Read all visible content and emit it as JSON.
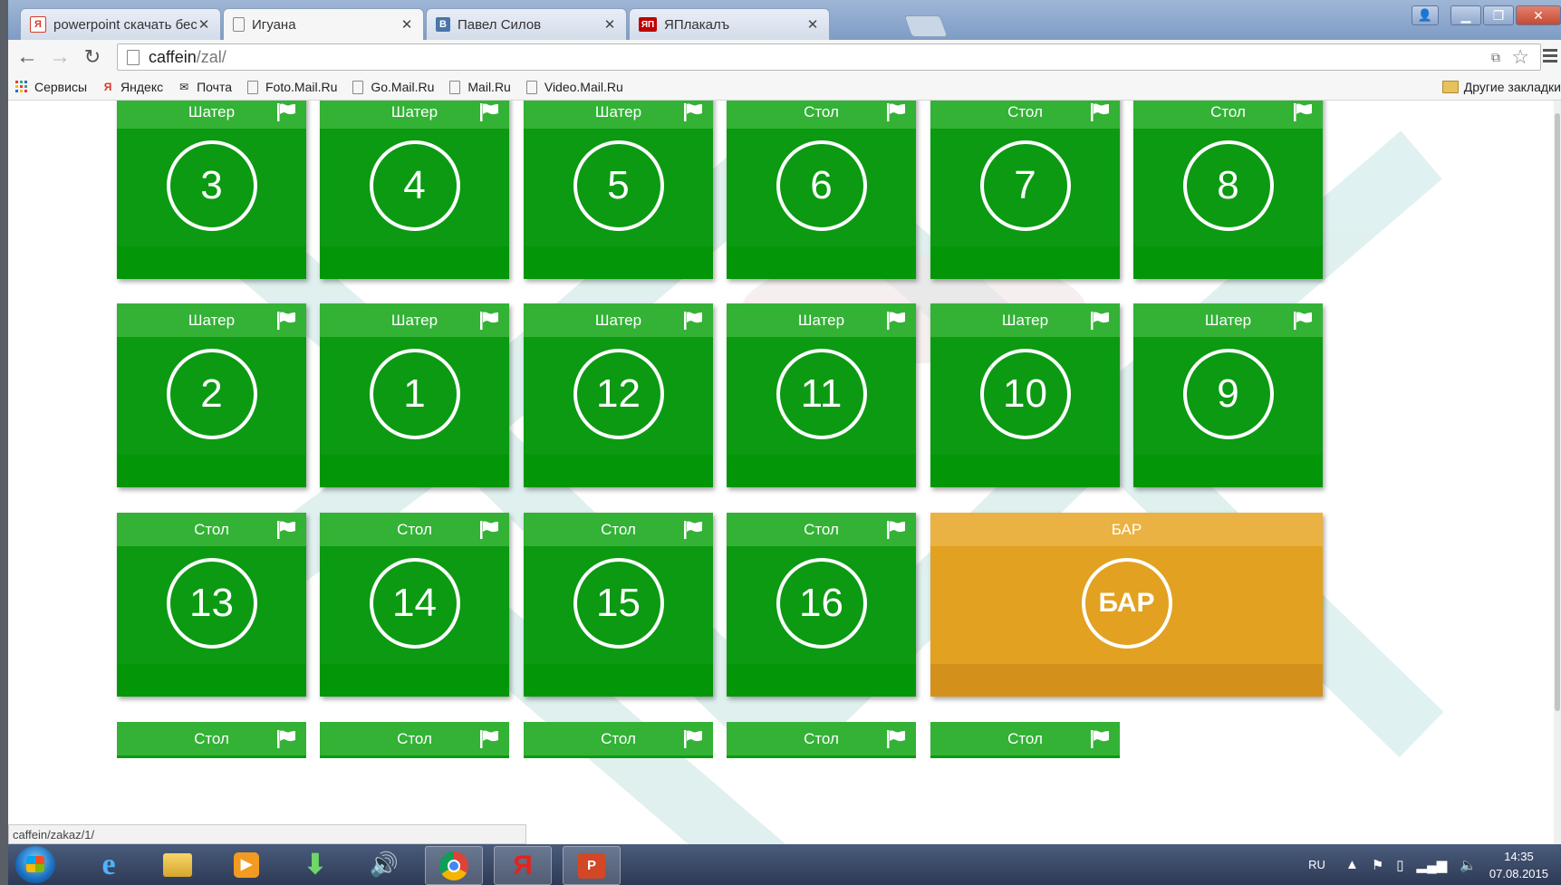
{
  "browser": {
    "tabs": [
      {
        "label": "powerpoint скачать бесп",
        "icon": "yandex-favicon",
        "icon_char": "Я",
        "icon_color": "#d63b2a"
      },
      {
        "label": "Игуана",
        "icon": "page-favicon",
        "icon_char": "",
        "icon_color": "#ffffff"
      },
      {
        "label": "Павел Силов",
        "icon": "vk-favicon",
        "icon_char": "В",
        "icon_color": "#4a76a8"
      },
      {
        "label": "ЯПлакалъ",
        "icon": "yaplakal-favicon",
        "icon_char": "ЯП",
        "icon_color": "#c00000"
      }
    ],
    "active_tab": 1,
    "url_host": "caffein",
    "url_path": "/zal/",
    "bookmarks": [
      {
        "label": "Сервисы",
        "icon": "apps-grid-icon"
      },
      {
        "label": "Яндекс",
        "icon": "yandex-icon"
      },
      {
        "label": "Почта",
        "icon": "mail-icon"
      },
      {
        "label": "Foto.Mail.Ru",
        "icon": "file-icon"
      },
      {
        "label": "Go.Mail.Ru",
        "icon": "file-icon"
      },
      {
        "label": "Mail.Ru",
        "icon": "file-icon"
      },
      {
        "label": "Video.Mail.Ru",
        "icon": "file-icon"
      }
    ],
    "other_bookmarks": "Другие закладки",
    "status_url": "caffein/zakaz/1/"
  },
  "hall": {
    "colors": {
      "green": "#0b9a12",
      "bar": "#e2a120"
    },
    "rows": [
      [
        {
          "type": "Шатер",
          "number": "3"
        },
        {
          "type": "Шатер",
          "number": "4"
        },
        {
          "type": "Шатер",
          "number": "5"
        },
        {
          "type": "Стол",
          "number": "6"
        },
        {
          "type": "Стол",
          "number": "7"
        },
        {
          "type": "Стол",
          "number": "8"
        }
      ],
      [
        {
          "type": "Шатер",
          "number": "2"
        },
        {
          "type": "Шатер",
          "number": "1"
        },
        {
          "type": "Шатер",
          "number": "12"
        },
        {
          "type": "Шатер",
          "number": "11"
        },
        {
          "type": "Шатер",
          "number": "10"
        },
        {
          "type": "Шатер",
          "number": "9"
        }
      ],
      [
        {
          "type": "Стол",
          "number": "13"
        },
        {
          "type": "Стол",
          "number": "14"
        },
        {
          "type": "Стол",
          "number": "15"
        },
        {
          "type": "Стол",
          "number": "16"
        }
      ]
    ],
    "bar": {
      "type": "БАР",
      "label": "БАР"
    },
    "partial_row": [
      "Стол",
      "Стол",
      "Стол",
      "Стол",
      "Стол"
    ]
  },
  "taskbar": {
    "apps": [
      "windows-start",
      "internet-explorer-icon",
      "file-explorer-icon",
      "media-player-icon",
      "download-icon",
      "speaker-app-icon",
      "chrome-icon",
      "yandex-browser-icon",
      "powerpoint-icon"
    ],
    "language": "RU",
    "time": "14:35",
    "date": "07.08.2015"
  }
}
